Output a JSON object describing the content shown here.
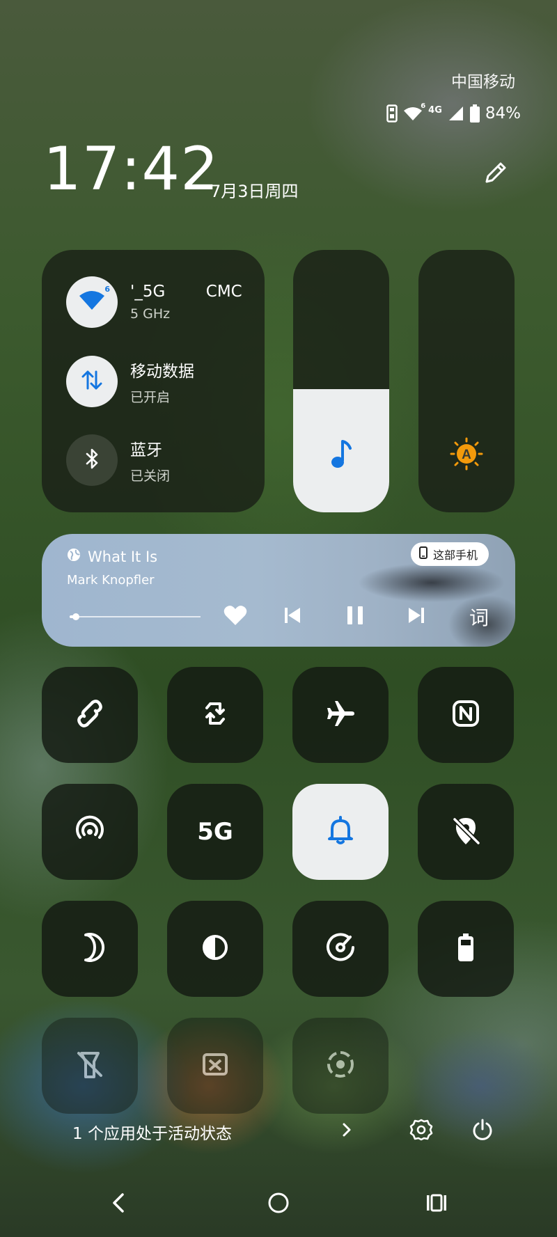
{
  "status_bar": {
    "carrier": "中国移动",
    "network_type": "4G",
    "wifi_badge": "6",
    "battery_percent": "84%"
  },
  "header": {
    "time": "17:42",
    "date": "7月3日周四"
  },
  "connectivity": {
    "wifi": {
      "name": "'_5G        CMC",
      "band": "5 GHz",
      "state": "on"
    },
    "mobile_data": {
      "title": "移动数据",
      "status": "已开启",
      "state": "on"
    },
    "bluetooth": {
      "title": "蓝牙",
      "status": "已关闭",
      "state": "off"
    }
  },
  "sliders": {
    "volume": {
      "level": 0.47,
      "icon": "music-note-icon"
    },
    "brightness": {
      "level": 0.0,
      "mode": "auto",
      "icon": "auto-brightness-icon"
    }
  },
  "media": {
    "title": "What It Is",
    "artist": "Mark Knopfler",
    "output_device": "这部手机",
    "progress": 0.05,
    "lyrics_label": "词"
  },
  "quick_toggles": [
    {
      "icon": "link-icon",
      "state": "off"
    },
    {
      "icon": "auto-rotate-icon",
      "state": "off"
    },
    {
      "icon": "airplane-icon",
      "state": "off"
    },
    {
      "icon": "nfc-icon",
      "state": "off"
    },
    {
      "icon": "hotspot-icon",
      "state": "off"
    },
    {
      "icon": "5g-icon",
      "label": "5G",
      "state": "off"
    },
    {
      "icon": "bell-icon",
      "state": "on"
    },
    {
      "icon": "location-off-icon",
      "state": "off"
    },
    {
      "icon": "dark-mode-icon",
      "state": "off"
    },
    {
      "icon": "contrast-icon",
      "state": "off"
    },
    {
      "icon": "focus-mode-icon",
      "state": "off"
    },
    {
      "icon": "battery-saver-icon",
      "state": "off"
    },
    {
      "icon": "flashlight-off-icon",
      "state": "off"
    },
    {
      "icon": "screenshot-icon",
      "state": "off"
    },
    {
      "icon": "screen-record-icon",
      "state": "off"
    }
  ],
  "footer": {
    "active_apps": "1 个应用处于活动状态"
  },
  "colors": {
    "accent_blue": "#1476e0",
    "auto_brightness_orange": "#f39a0b",
    "tile_on": "#eceeef",
    "panel_dark": "#181e16"
  }
}
